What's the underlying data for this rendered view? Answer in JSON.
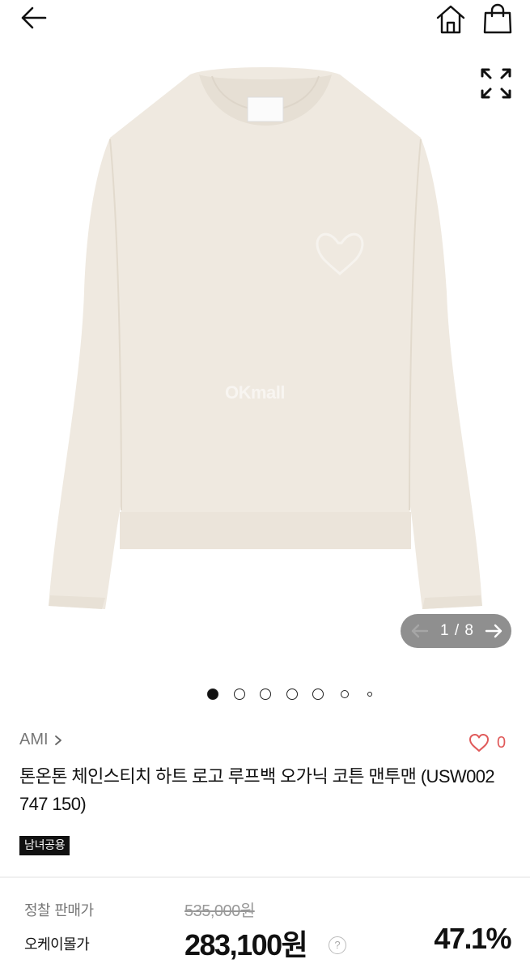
{
  "header": {
    "back_icon": "arrow-left-icon",
    "home_icon": "home-icon",
    "cart_icon": "shopping-bag-icon"
  },
  "gallery": {
    "watermark": "OKmall",
    "expand_icon": "expand-icon",
    "current": "1",
    "total": "8",
    "counter_text": "1 / 8",
    "dot_count": 7,
    "active_dot": 0,
    "garment_color": "#efe9e0"
  },
  "product": {
    "brand": "AMI",
    "wish_count": "0",
    "title": "톤온톤 체인스티치 하트 로고 루프백 오가닉 코튼 맨투맨 (USW002 747 150)",
    "gender_badge": "남녀공용"
  },
  "price": {
    "regular_label": "정찰 판매가",
    "regular_value": "535,000원",
    "sale_label": "오케이몰가",
    "sale_value": "283,100원",
    "help_symbol": "?",
    "discount_rate": "47.1%"
  },
  "colors": {
    "wish": "#e05a5a",
    "counter_bg": "#646464"
  }
}
